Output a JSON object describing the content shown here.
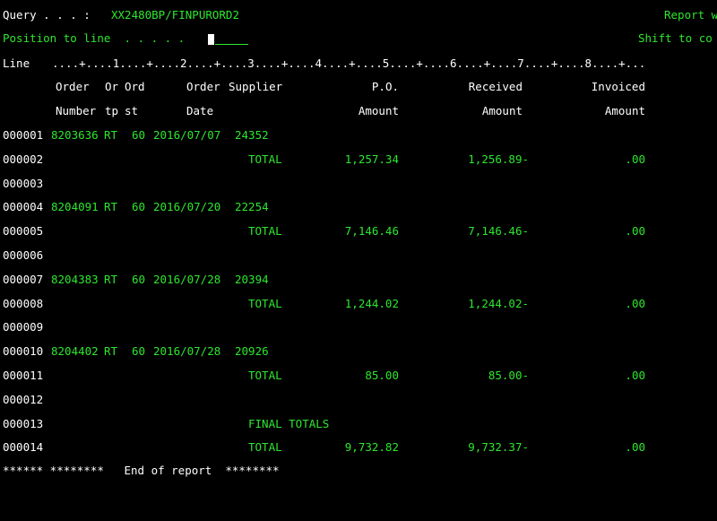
{
  "header": {
    "query_label": "Query . . . :",
    "query_value": "XX2480BP/FINPURORD2",
    "report_label": "Report w",
    "position_label": "Position to line  . . . . .",
    "shift_label": "Shift to co"
  },
  "ruler": {
    "line_label": "Line",
    "scale": "....+....1....+....2....+....3....+....4....+....5....+....6....+....7....+....8....+..."
  },
  "columns": {
    "h1": [
      "Order",
      "Or",
      "Ord",
      "Order",
      "Supplier",
      "P.O.",
      "Received",
      "Invoiced"
    ],
    "h2": [
      "Number",
      "tp",
      "st",
      "Date",
      "",
      "Amount",
      "Amount",
      "Amount"
    ]
  },
  "rows": [
    {
      "line": "000001",
      "order": "8203636",
      "tp": "RT",
      "st": "60",
      "date": "2016/07/07",
      "supplier": "24352",
      "label": "",
      "po": "",
      "received": "",
      "invoiced": ""
    },
    {
      "line": "000002",
      "order": "",
      "tp": "",
      "st": "",
      "date": "",
      "supplier": "",
      "label": "TOTAL",
      "po": "1,257.34",
      "received": "1,256.89-",
      "invoiced": ".00"
    },
    {
      "line": "000003",
      "order": "",
      "tp": "",
      "st": "",
      "date": "",
      "supplier": "",
      "label": "",
      "po": "",
      "received": "",
      "invoiced": ""
    },
    {
      "line": "000004",
      "order": "8204091",
      "tp": "RT",
      "st": "60",
      "date": "2016/07/20",
      "supplier": "22254",
      "label": "",
      "po": "",
      "received": "",
      "invoiced": ""
    },
    {
      "line": "000005",
      "order": "",
      "tp": "",
      "st": "",
      "date": "",
      "supplier": "",
      "label": "TOTAL",
      "po": "7,146.46",
      "received": "7,146.46-",
      "invoiced": ".00"
    },
    {
      "line": "000006",
      "order": "",
      "tp": "",
      "st": "",
      "date": "",
      "supplier": "",
      "label": "",
      "po": "",
      "received": "",
      "invoiced": ""
    },
    {
      "line": "000007",
      "order": "8204383",
      "tp": "RT",
      "st": "60",
      "date": "2016/07/28",
      "supplier": "20394",
      "label": "",
      "po": "",
      "received": "",
      "invoiced": ""
    },
    {
      "line": "000008",
      "order": "",
      "tp": "",
      "st": "",
      "date": "",
      "supplier": "",
      "label": "TOTAL",
      "po": "1,244.02",
      "received": "1,244.02-",
      "invoiced": ".00"
    },
    {
      "line": "000009",
      "order": "",
      "tp": "",
      "st": "",
      "date": "",
      "supplier": "",
      "label": "",
      "po": "",
      "received": "",
      "invoiced": ""
    },
    {
      "line": "000010",
      "order": "8204402",
      "tp": "RT",
      "st": "60",
      "date": "2016/07/28",
      "supplier": "20926",
      "label": "",
      "po": "",
      "received": "",
      "invoiced": ""
    },
    {
      "line": "000011",
      "order": "",
      "tp": "",
      "st": "",
      "date": "",
      "supplier": "",
      "label": "TOTAL",
      "po": "85.00",
      "received": "85.00-",
      "invoiced": ".00"
    },
    {
      "line": "000012",
      "order": "",
      "tp": "",
      "st": "",
      "date": "",
      "supplier": "",
      "label": "",
      "po": "",
      "received": "",
      "invoiced": ""
    },
    {
      "line": "000013",
      "order": "",
      "tp": "",
      "st": "",
      "date": "",
      "supplier": "",
      "label": "FINAL TOTALS",
      "po": "",
      "received": "",
      "invoiced": ""
    },
    {
      "line": "000014",
      "order": "",
      "tp": "",
      "st": "",
      "date": "",
      "supplier": "",
      "label": "TOTAL",
      "po": "9,732.82",
      "received": "9,732.37-",
      "invoiced": ".00"
    }
  ],
  "footer": {
    "text": "****** ********   End of report  ********"
  },
  "colors": {
    "text_green": "#2ee62e",
    "text_white": "#ffffff",
    "background": "#000000"
  }
}
